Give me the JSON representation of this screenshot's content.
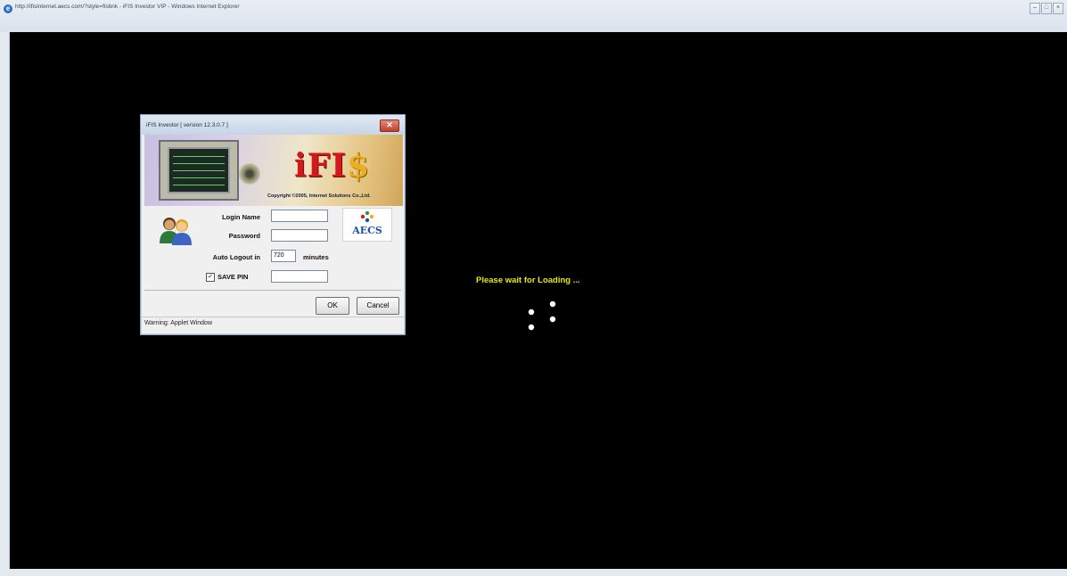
{
  "browser": {
    "window_title": "http://ifisinternet.aecs.com/?style=fisbnk - iFIS Investor VIP - Windows Internet Explorer",
    "icon": "ie-icon",
    "controls": [
      "minimize-icon",
      "restore-icon",
      "close-icon"
    ]
  },
  "applet": {
    "title": "iFIS  Investor  [ version 12.3.0.7 ]",
    "close_label": "✕",
    "banner": {
      "logo_main": "iFI",
      "logo_dollar": "$",
      "copyright": "Copyright ©2005, Internet Solutions Co.,Ltd."
    },
    "login_name": {
      "label": "Login Name",
      "value": ""
    },
    "password": {
      "label": "Password",
      "value": ""
    },
    "auto_logout": {
      "label": "Auto Logout in",
      "value": "720",
      "unit": "minutes"
    },
    "save_pin": {
      "label": "SAVE PIN",
      "checked": true,
      "value": ""
    },
    "brand": "AECS",
    "buttons": {
      "ok": "OK",
      "cancel": "Cancel"
    },
    "warning": "Warning: Applet Window"
  },
  "loading": {
    "text": "Please wait for Loading ...",
    "color": "#e8e800"
  },
  "colors": {
    "background": "#000000",
    "logo_red": "#d21a1a",
    "logo_gold": "#e8b020",
    "brand_blue": "#1a4fa8"
  }
}
